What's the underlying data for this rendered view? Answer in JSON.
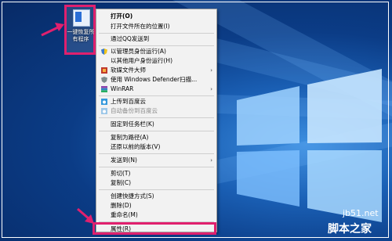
{
  "desktop": {
    "icon_label": "一键恢复所有程序"
  },
  "menu": {
    "items": [
      {
        "label": "打开(O)",
        "icon": "none"
      },
      {
        "label": "打开文件所在的位置(I)",
        "icon": "none"
      },
      {
        "label": "通过QQ发送到",
        "icon": "none"
      },
      {
        "label": "以管理员身份运行(A)",
        "icon": "shield-icon"
      },
      {
        "label": "以其他用户身份运行(H)",
        "icon": "none"
      },
      {
        "label": "软媒文件大师",
        "icon": "app-icon",
        "submenu": "›"
      },
      {
        "label": "使用 Windows Defender扫描...",
        "icon": "defender-icon"
      },
      {
        "label": "WinRAR",
        "icon": "winrar-icon",
        "submenu": "›"
      },
      {
        "label": "上传到百度云",
        "icon": "cloud-icon"
      },
      {
        "label": "自动备份到百度云",
        "icon": "cloud-icon",
        "disabled": true
      },
      {
        "label": "固定到任务栏(K)",
        "icon": "none"
      },
      {
        "label": "复制为路径(A)",
        "icon": "none"
      },
      {
        "label": "还原以前的版本(V)",
        "icon": "none"
      },
      {
        "label": "发送到(N)",
        "icon": "none",
        "submenu": "›"
      },
      {
        "label": "剪切(T)",
        "icon": "none"
      },
      {
        "label": "复制(C)",
        "icon": "none"
      },
      {
        "label": "创建快捷方式(S)",
        "icon": "none"
      },
      {
        "label": "删除(D)",
        "icon": "none"
      },
      {
        "label": "重命名(M)",
        "icon": "none"
      },
      {
        "label": "属性(R)",
        "icon": "none"
      }
    ]
  },
  "watermark": {
    "line1": "jb51.net",
    "line2": "脚本之家"
  },
  "colors": {
    "highlight": "#e0206e",
    "menu_bg": "#f2f2f2"
  }
}
